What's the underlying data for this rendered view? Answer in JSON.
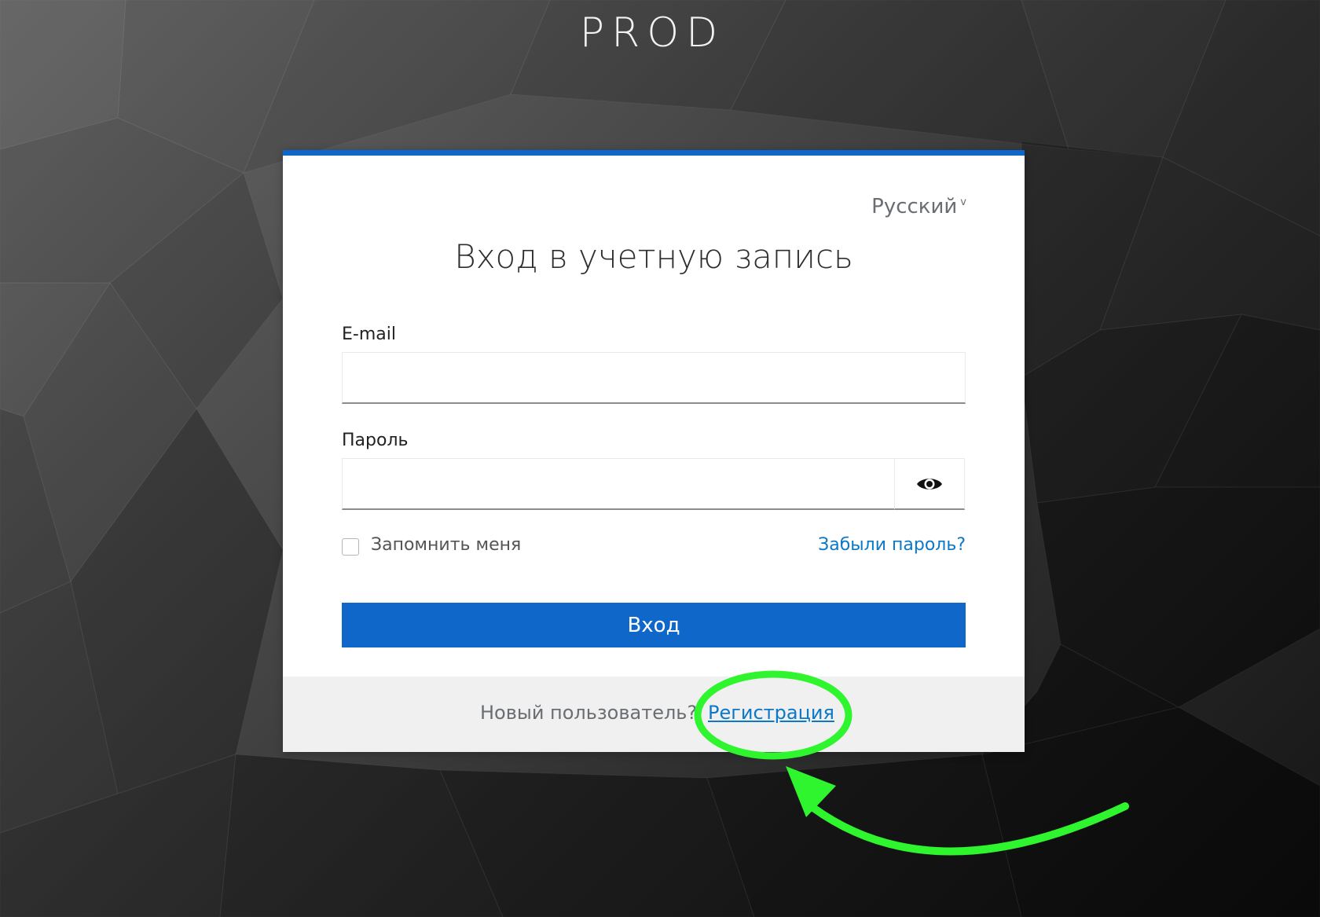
{
  "realm": {
    "title": "PROD"
  },
  "login": {
    "language": "Русский",
    "language_chevron": "v",
    "title": "Вход в учетную запись",
    "email_label": "E-mail",
    "email_value": "",
    "password_label": "Пароль",
    "password_value": "",
    "remember_label": "Запомнить меня",
    "remember_checked": false,
    "forgot_link": "Забыли пароль?",
    "submit_label": "Вход",
    "new_user_text": "Новый пользователь?",
    "register_link": "Регистрация"
  },
  "colors": {
    "accent": "#0f68c9",
    "link": "#0b78c8",
    "annotation": "#2ef52e"
  },
  "icons": {
    "password_toggle": "eye-icon",
    "language_toggle": "chevron-down-icon"
  },
  "annotation": {
    "type": "highlight-ellipse-with-arrow",
    "target": "register_link"
  }
}
